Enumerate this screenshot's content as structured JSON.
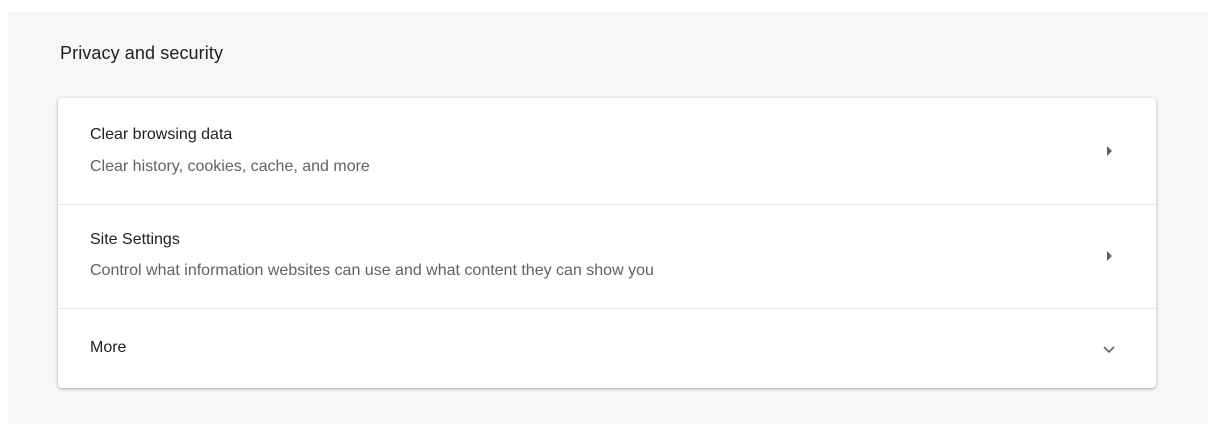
{
  "section": {
    "title": "Privacy and security"
  },
  "rows": [
    {
      "label": "Clear browsing data",
      "sublabel": "Clear history, cookies, cache, and more",
      "icon": "arrow-right-icon"
    },
    {
      "label": "Site Settings",
      "sublabel": "Control what information websites can use and what content they can show you",
      "icon": "arrow-right-icon"
    },
    {
      "label": "More",
      "icon": "chevron-down-icon"
    }
  ],
  "colors": {
    "page_background": "#f7f7f7",
    "card_background": "#ffffff",
    "primary_text": "#202124",
    "secondary_text": "#5f6368",
    "divider": "#e6e6e6"
  }
}
